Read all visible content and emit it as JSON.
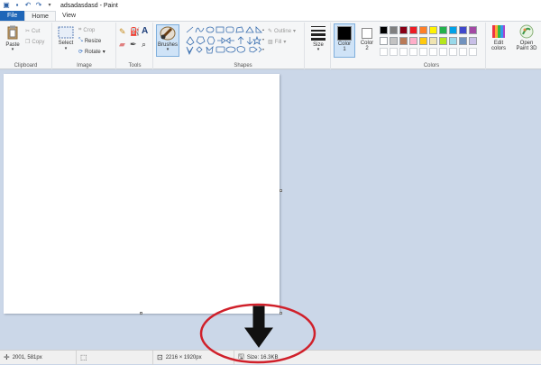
{
  "window": {
    "title": "adsadasdasd - Paint"
  },
  "tabs": {
    "file": "File",
    "home": "Home",
    "view": "View"
  },
  "clipboard": {
    "paste": "Paste",
    "cut": "Cut",
    "copy": "Copy",
    "label": "Clipboard"
  },
  "image": {
    "select": "Select",
    "crop": "Crop",
    "resize": "Resize",
    "rotate": "Rotate",
    "label": "Image"
  },
  "tools": {
    "label": "Tools",
    "text_tool": "A"
  },
  "brushes": {
    "label": "Brushes"
  },
  "shapes": {
    "outline": "Outline",
    "fill": "Fill",
    "label": "Shapes"
  },
  "size": {
    "label": "Size"
  },
  "color1": {
    "line1": "Color",
    "line2": "1"
  },
  "color2": {
    "line1": "Color",
    "line2": "2"
  },
  "colors": {
    "label": "Colors",
    "edit_line1": "Edit",
    "edit_line2": "colors",
    "color1_value": "#000000",
    "color2_value": "#ffffff",
    "palette_row1": [
      "#000000",
      "#7f7f7f",
      "#880015",
      "#ed1c24",
      "#ff7f27",
      "#fff200",
      "#22b14c",
      "#00a2e8",
      "#3f48cc",
      "#a349a4"
    ],
    "palette_row2": [
      "#ffffff",
      "#c3c3c3",
      "#b97a57",
      "#ffaec9",
      "#ffc90e",
      "#efe4b0",
      "#b5e61d",
      "#99d9ea",
      "#7092be",
      "#c8bfe7"
    ]
  },
  "paint3d": {
    "line1": "Open",
    "line2": "Paint 3D"
  },
  "status": {
    "cursor": "2001, 581px",
    "dimensions": "2216 × 1920px",
    "size": "Size: 16.3KB"
  },
  "annotation": {
    "ellipse_color": "#d0202a",
    "arrow_color": "#111111"
  }
}
